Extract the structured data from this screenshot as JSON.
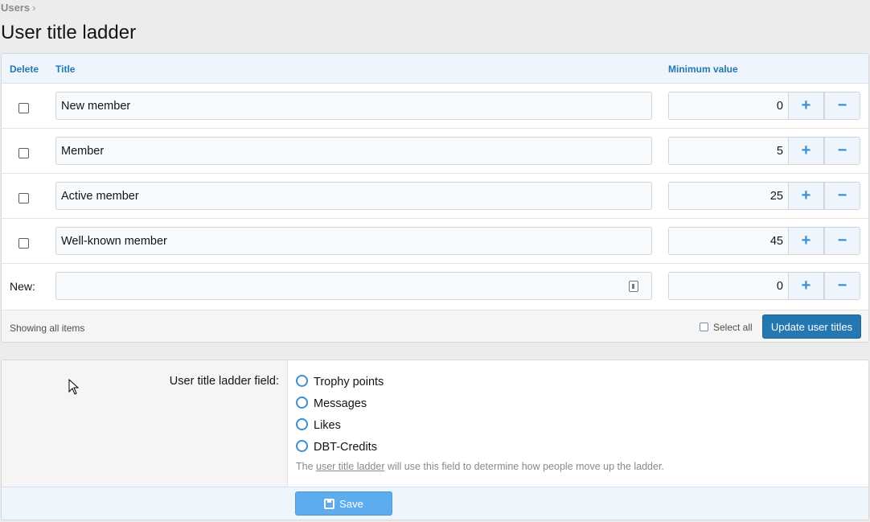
{
  "breadcrumb": {
    "item": "Users",
    "separator": "›"
  },
  "page": {
    "title": "User title ladder"
  },
  "table": {
    "headers": {
      "delete": "Delete",
      "title": "Title",
      "min_value": "Minimum value"
    },
    "rows": [
      {
        "title": "New member",
        "min": "0"
      },
      {
        "title": "Member",
        "min": "5"
      },
      {
        "title": "Active member",
        "min": "25"
      },
      {
        "title": "Well-known member",
        "min": "45"
      }
    ],
    "new_row": {
      "label": "New:",
      "title": "",
      "min": "0"
    },
    "stepper": {
      "plus": "+",
      "minus": "−"
    },
    "footer": {
      "showing": "Showing all items",
      "select_all": "Select all",
      "update_button": "Update user titles"
    }
  },
  "form": {
    "field_label": "User title ladder field:",
    "options": [
      "Trophy points",
      "Messages",
      "Likes",
      "DBT-Credits"
    ],
    "explain": {
      "prefix": "The ",
      "link": "user title ladder",
      "suffix": " will use this field to determine how people move up the ladder."
    },
    "save_button": "Save"
  },
  "colors": {
    "accent": "#2577b1",
    "stepper": "#3d8fcf",
    "save": "#5dacee"
  },
  "icons": {
    "save": "floppy-disk-icon",
    "cursor": "mouse-pointer-icon"
  }
}
